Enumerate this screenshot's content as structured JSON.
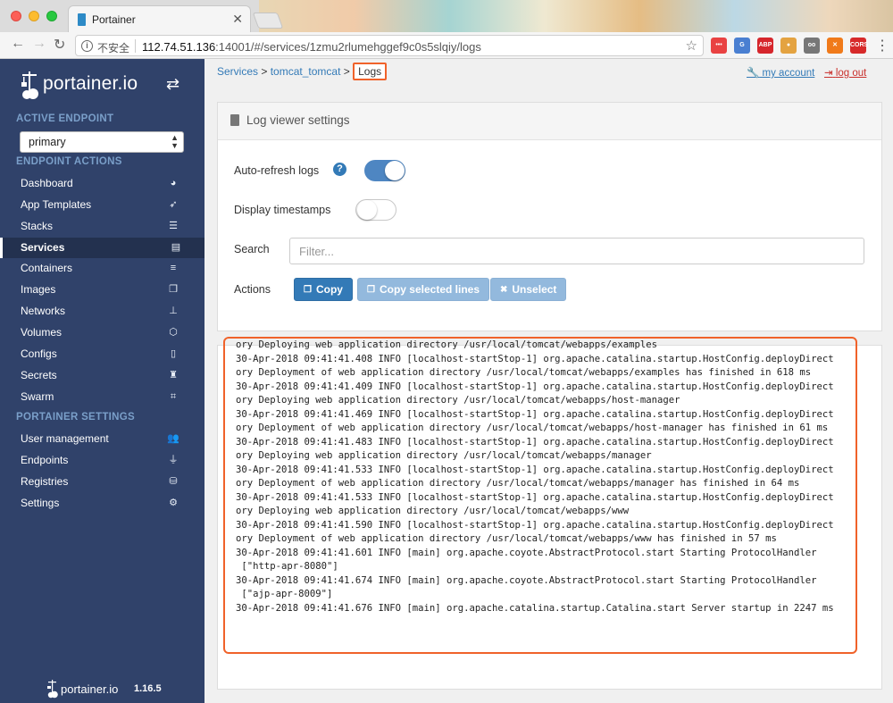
{
  "browser": {
    "tab_title": "Portainer",
    "tab_close": "✕",
    "insecure_label": "不安全",
    "url_host": "112.74.51.136",
    "url_rest": ":14001/#/services/1zmu2rlumehggef9c0s5slqiy/logs",
    "extensions": [
      {
        "name": "ext-dots-icon",
        "label": "•••",
        "color": "#e94242"
      },
      {
        "name": "ext-translate-icon",
        "label": "G",
        "color": "#4a7fd1"
      },
      {
        "name": "ext-abp-icon",
        "label": "ABP",
        "color": "#d6262c"
      },
      {
        "name": "ext-circle-icon",
        "label": "●",
        "color": "#e4a341"
      },
      {
        "name": "ext-glasses-icon",
        "label": "oo",
        "color": "#777777"
      },
      {
        "name": "ext-x-icon",
        "label": "✕",
        "color": "#f07a1a"
      },
      {
        "name": "ext-cors-icon",
        "label": "CORS",
        "color": "#d72a2a"
      }
    ]
  },
  "sidebar": {
    "logo_text": "portainer.io",
    "active_endpoint_header": "ACTIVE ENDPOINT",
    "endpoint_value": "primary",
    "endpoint_actions_header": "ENDPOINT ACTIONS",
    "endpoint_items": [
      {
        "label": "Dashboard",
        "icon": "dashboard-icon",
        "glyph": "◕"
      },
      {
        "label": "App Templates",
        "icon": "rocket-icon",
        "glyph": "➶"
      },
      {
        "label": "Stacks",
        "icon": "list-icon",
        "glyph": "☰"
      },
      {
        "label": "Services",
        "icon": "list-alt-icon",
        "glyph": "▤"
      },
      {
        "label": "Containers",
        "icon": "server-icon",
        "glyph": "≡"
      },
      {
        "label": "Images",
        "icon": "clone-icon",
        "glyph": "❐"
      },
      {
        "label": "Networks",
        "icon": "sitemap-icon",
        "glyph": "⊥"
      },
      {
        "label": "Volumes",
        "icon": "cubes-icon",
        "glyph": "⬡"
      },
      {
        "label": "Configs",
        "icon": "file-code-icon",
        "glyph": "▯"
      },
      {
        "label": "Secrets",
        "icon": "user-secret-icon",
        "glyph": "♜"
      },
      {
        "label": "Swarm",
        "icon": "object-group-icon",
        "glyph": "⌗"
      }
    ],
    "settings_header": "PORTAINER SETTINGS",
    "settings_items": [
      {
        "label": "User management",
        "icon": "users-icon",
        "glyph": "👥"
      },
      {
        "label": "Endpoints",
        "icon": "plug-icon",
        "glyph": "⏚"
      },
      {
        "label": "Registries",
        "icon": "database-icon",
        "glyph": "⛁"
      },
      {
        "label": "Settings",
        "icon": "cogs-icon",
        "glyph": "⚙"
      }
    ],
    "footer_text": "portainer.io",
    "footer_version": "1.16.5"
  },
  "header": {
    "breadcrumb_services": "Services",
    "breadcrumb_sep1": " > ",
    "breadcrumb_service": "tomcat_tomcat",
    "breadcrumb_sep2": " > ",
    "breadcrumb_current": "Logs",
    "my_account": "my account",
    "log_out": "log out"
  },
  "settings_panel": {
    "title": "Log viewer settings",
    "auto_refresh_label": "Auto-refresh logs",
    "auto_refresh_on": true,
    "timestamps_label": "Display timestamps",
    "timestamps_on": false,
    "search_label": "Search",
    "search_placeholder": "Filter...",
    "actions_label": "Actions",
    "copy_button": "Copy",
    "copy_selected_button": "Copy selected lines",
    "unselect_button": "Unselect"
  },
  "logs": {
    "lines": [
      "ory Deploying web application directory /usr/local/tomcat/webapps/examples",
      "30-Apr-2018 09:41:41.408 INFO [localhost-startStop-1] org.apache.catalina.startup.HostConfig.deployDirect",
      "ory Deployment of web application directory /usr/local/tomcat/webapps/examples has finished in 618 ms",
      "30-Apr-2018 09:41:41.409 INFO [localhost-startStop-1] org.apache.catalina.startup.HostConfig.deployDirect",
      "ory Deploying web application directory /usr/local/tomcat/webapps/host-manager",
      "30-Apr-2018 09:41:41.469 INFO [localhost-startStop-1] org.apache.catalina.startup.HostConfig.deployDirect",
      "ory Deployment of web application directory /usr/local/tomcat/webapps/host-manager has finished in 61 ms",
      "30-Apr-2018 09:41:41.483 INFO [localhost-startStop-1] org.apache.catalina.startup.HostConfig.deployDirect",
      "ory Deploying web application directory /usr/local/tomcat/webapps/manager",
      "30-Apr-2018 09:41:41.533 INFO [localhost-startStop-1] org.apache.catalina.startup.HostConfig.deployDirect",
      "ory Deployment of web application directory /usr/local/tomcat/webapps/manager has finished in 64 ms",
      "30-Apr-2018 09:41:41.533 INFO [localhost-startStop-1] org.apache.catalina.startup.HostConfig.deployDirect",
      "ory Deploying web application directory /usr/local/tomcat/webapps/www",
      "30-Apr-2018 09:41:41.590 INFO [localhost-startStop-1] org.apache.catalina.startup.HostConfig.deployDirect",
      "ory Deployment of web application directory /usr/local/tomcat/webapps/www has finished in 57 ms",
      "30-Apr-2018 09:41:41.601 INFO [main] org.apache.coyote.AbstractProtocol.start Starting ProtocolHandler",
      " [\"http-apr-8080\"]",
      "30-Apr-2018 09:41:41.674 INFO [main] org.apache.coyote.AbstractProtocol.start Starting ProtocolHandler",
      " [\"ajp-apr-8009\"]",
      "30-Apr-2018 09:41:41.676 INFO [main] org.apache.catalina.startup.Catalina.start Server startup in 2247 ms"
    ]
  },
  "colors": {
    "sidebar_bg": "#30426a",
    "accent": "#337ab7",
    "highlight": "#f0622a"
  }
}
